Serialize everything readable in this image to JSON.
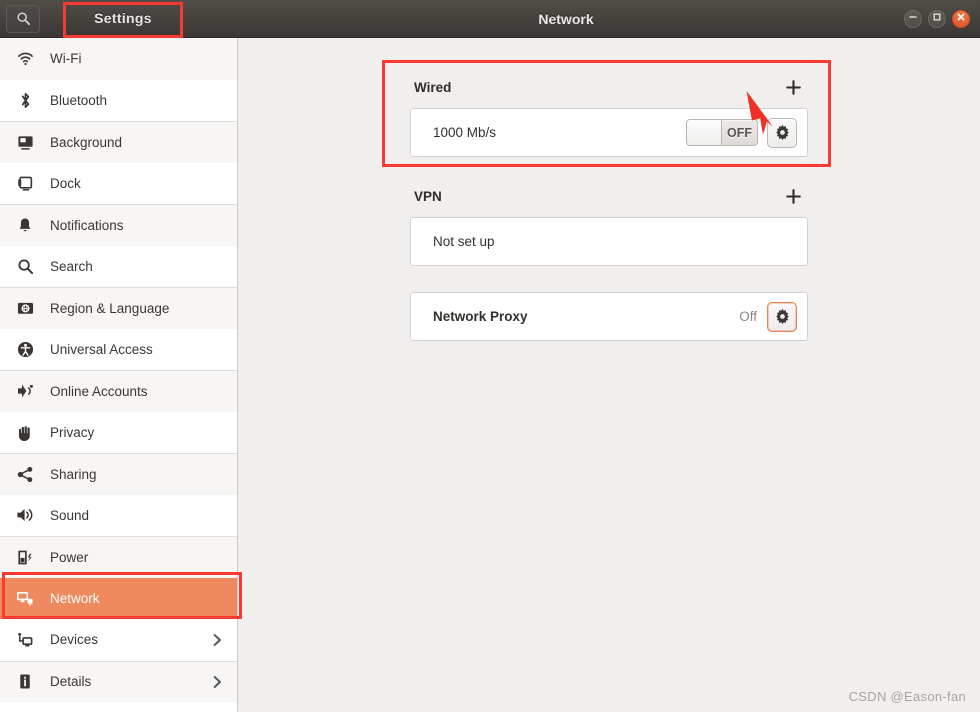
{
  "titlebar": {
    "search_icon": "search-icon",
    "settings_label": "Settings",
    "window_title": "Network",
    "minimize_label": "–",
    "maximize_label": "□",
    "close_label": "✕"
  },
  "sidebar": {
    "items": [
      {
        "label": "Wi-Fi",
        "icon": "wifi-icon",
        "chevron": false,
        "active": false
      },
      {
        "label": "Bluetooth",
        "icon": "bluetooth-icon",
        "chevron": false,
        "active": false
      },
      {
        "label": "Background",
        "icon": "background-icon",
        "chevron": false,
        "active": false
      },
      {
        "label": "Dock",
        "icon": "dock-icon",
        "chevron": false,
        "active": false
      },
      {
        "label": "Notifications",
        "icon": "bell-icon",
        "chevron": false,
        "active": false
      },
      {
        "label": "Search",
        "icon": "search-icon",
        "chevron": false,
        "active": false
      },
      {
        "label": "Region & Language",
        "icon": "region-language-icon",
        "chevron": false,
        "active": false
      },
      {
        "label": "Universal Access",
        "icon": "accessibility-icon",
        "chevron": false,
        "active": false
      },
      {
        "label": "Online Accounts",
        "icon": "online-accounts-icon",
        "chevron": false,
        "active": false
      },
      {
        "label": "Privacy",
        "icon": "hand-icon",
        "chevron": false,
        "active": false
      },
      {
        "label": "Sharing",
        "icon": "share-icon",
        "chevron": false,
        "active": false
      },
      {
        "label": "Sound",
        "icon": "speaker-icon",
        "chevron": false,
        "active": false
      },
      {
        "label": "Power",
        "icon": "battery-icon",
        "chevron": false,
        "active": false
      },
      {
        "label": "Network",
        "icon": "network-icon",
        "chevron": false,
        "active": true
      },
      {
        "label": "Devices",
        "icon": "devices-icon",
        "chevron": true,
        "active": false
      },
      {
        "label": "Details",
        "icon": "info-icon",
        "chevron": true,
        "active": false
      }
    ]
  },
  "main": {
    "wired": {
      "title": "Wired",
      "add_label": "+",
      "speed": "1000 Mb/s",
      "toggle_state": "OFF",
      "settings_icon": "gear-icon"
    },
    "vpn": {
      "title": "VPN",
      "add_label": "+",
      "status": "Not set up"
    },
    "proxy": {
      "title": "Network Proxy",
      "status": "Off",
      "settings_icon": "gear-icon"
    }
  },
  "annotations": {
    "settings_box": "red-highlight-box",
    "wired_box": "red-highlight-box",
    "network_box": "red-highlight-box",
    "arrow": "red-arrow-pointing-to-wired-settings-gear"
  },
  "watermark": "CSDN @Eason-fan",
  "colors": {
    "accent": "#ef8a5e",
    "annotation_red": "#f93a33",
    "titlebar_dark": "#46423e",
    "content_bg": "#f1efee",
    "close_button": "#e2572c"
  }
}
